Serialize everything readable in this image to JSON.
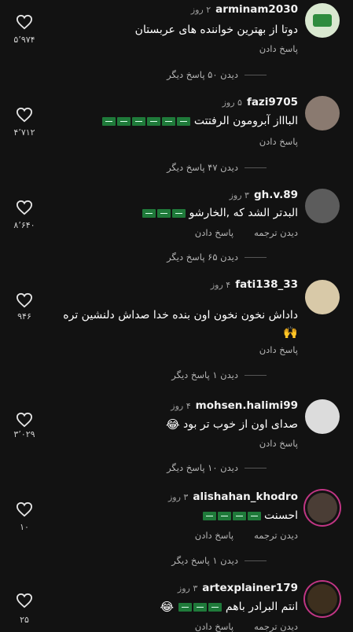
{
  "colors": {
    "background": "#121212",
    "text": "#ffffff",
    "muted": "#b5b5b5"
  },
  "comments": [
    {
      "username": "arminam2030",
      "time": "۲ روز",
      "text": "دوتا از بهترین خواننده های عربستان",
      "reply": "پاسخ دادن",
      "translate": "",
      "more": "دیدن ۵۰ پاسخ دیگر",
      "likes": "۵٬۹۷۴",
      "flags": 0,
      "emoji": ""
    },
    {
      "username": "fazi9705",
      "time": "۵ روز",
      "text": "الباااز آبرومون الرفتتت",
      "reply": "پاسخ دادن",
      "translate": "",
      "more": "دیدن ۴۷ پاسخ دیگر",
      "likes": "۴٬۷۱۲",
      "flags": 6,
      "emoji": ""
    },
    {
      "username": "gh.v.89",
      "time": "۳ روز",
      "text": "البدتر الشد که ,الخارشو",
      "reply": "پاسخ دادن",
      "translate": "دیدن ترجمه",
      "more": "دیدن ۶۵ پاسخ دیگر",
      "likes": "۸٬۶۴۰",
      "flags": 3,
      "emoji": ""
    },
    {
      "username": "fati138_33",
      "time": "۴ روز",
      "text": "داداش نخون نخون اون بنده خدا صداش دلنشین تره",
      "reply": "پاسخ دادن",
      "translate": "",
      "more": "دیدن ۱ پاسخ دیگر",
      "likes": "۹۴۶",
      "flags": 0,
      "emoji": "🙌"
    },
    {
      "username": "mohsen.halimi99",
      "time": "۴ روز",
      "text": "صدای اون از خوب تر بود",
      "reply": "پاسخ دادن",
      "translate": "",
      "more": "دیدن ۱۰ پاسخ دیگر",
      "likes": "۳٬۰۲۹",
      "flags": 0,
      "emoji": "😂"
    },
    {
      "username": "alishahan_khodro",
      "time": "۳ روز",
      "text": "احسنت",
      "reply": "پاسخ دادن",
      "translate": "دیدن ترجمه",
      "more": "دیدن ۱ پاسخ دیگر",
      "likes": "۱۰",
      "flags": 4,
      "emoji": ""
    },
    {
      "username": "artexplainer179",
      "time": "۳ روز",
      "text": "انتم البرادر باهم",
      "reply": "پاسخ دادن",
      "translate": "دیدن ترجمه",
      "more": "",
      "likes": "۲۵",
      "flags": 3,
      "emoji": "😂"
    }
  ]
}
